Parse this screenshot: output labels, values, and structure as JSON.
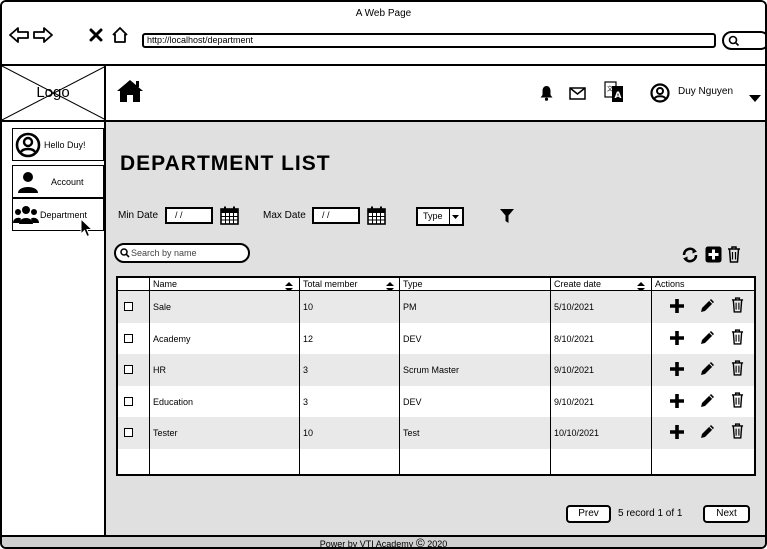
{
  "browser": {
    "window_title": "A Web Page",
    "url": "http://localhost/department",
    "icons": [
      "back-arrow-icon",
      "forward-arrow-icon",
      "close-x-icon",
      "home-outline-icon",
      "search-icon"
    ]
  },
  "header": {
    "logo_label": "Logo",
    "user_name": "Duy Nguyen",
    "icons": [
      "home-icon",
      "bell-icon",
      "mail-icon",
      "translate-icon",
      "user-circle-icon",
      "caret-down-icon"
    ]
  },
  "sidebar": {
    "greeting": "Hello Duy!",
    "items": [
      {
        "label": "Account",
        "icon": "user-icon"
      },
      {
        "label": "Department",
        "icon": "group-icon"
      }
    ]
  },
  "page": {
    "title": "DEPARTMENT LIST",
    "filters": {
      "min_date_label": "Min Date",
      "min_date_value": "/ /",
      "max_date_label": "Max Date",
      "max_date_value": "/ /",
      "type_label": "Type"
    },
    "search_placeholder": "Search by name"
  },
  "table": {
    "headers": [
      "Name",
      "Total member",
      "Type",
      "Create date",
      "Actions"
    ],
    "rows": [
      {
        "name": "Sale",
        "total": "10",
        "type": "PM",
        "date": "5/10/2021"
      },
      {
        "name": "Academy",
        "total": "12",
        "type": "DEV",
        "date": "8/10/2021"
      },
      {
        "name": "HR",
        "total": "3",
        "type": "Scrum Master",
        "date": "9/10/2021"
      },
      {
        "name": "Education",
        "total": "3",
        "type": "DEV",
        "date": "9/10/2021"
      },
      {
        "name": "Tester",
        "total": "10",
        "type": "Test",
        "date": "10/10/2021"
      }
    ]
  },
  "pagination": {
    "prev": "Prev",
    "info": "5 record 1 of 1",
    "next": "Next"
  },
  "footer": {
    "text": "Power by VTI Academy",
    "copyright": "©",
    "year": "2020"
  }
}
